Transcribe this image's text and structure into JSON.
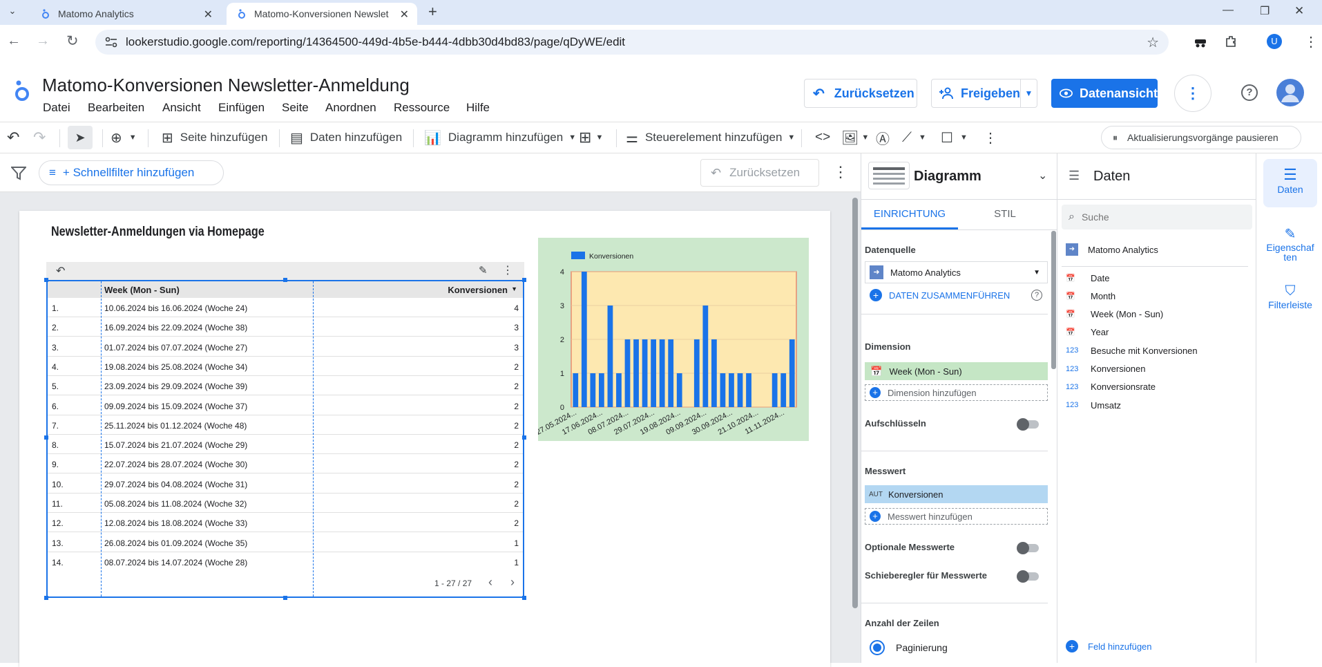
{
  "browser": {
    "tabs": [
      {
        "title": "Matomo Analytics"
      },
      {
        "title": "Matomo-Konversionen Newslet"
      }
    ],
    "url": "lookerstudio.google.com/reporting/14364500-449d-4b5e-b444-4dbb30d4bd83/page/qDyWE/edit",
    "profile_letter": "U"
  },
  "app": {
    "title": "Matomo-Konversionen Newsletter-Anmeldung",
    "menu": [
      "Datei",
      "Bearbeiten",
      "Ansicht",
      "Einfügen",
      "Seite",
      "Anordnen",
      "Ressource",
      "Hilfe"
    ],
    "reset_label": "Zurücksetzen",
    "share_label": "Freigeben",
    "view_label": "Datenansicht"
  },
  "toolbar": {
    "add_page": "Seite hinzufügen",
    "add_data": "Daten hinzufügen",
    "add_chart": "Diagramm hinzufügen",
    "add_control": "Steuerelement hinzufügen",
    "pause_updates": "Aktualisierungsvorgänge pausieren"
  },
  "filterbar": {
    "quickfilter": "+ Schnellfilter hinzufügen",
    "reset": "Zurücksetzen"
  },
  "report": {
    "title": "Newsletter-Anmeldungen via Homepage",
    "table": {
      "columns": [
        "Week (Mon - Sun)",
        "Konversionen"
      ],
      "rows": [
        {
          "n": "1.",
          "week": "10.06.2024 bis 16.06.2024 (Woche 24)",
          "value": "4"
        },
        {
          "n": "2.",
          "week": "16.09.2024 bis 22.09.2024 (Woche 38)",
          "value": "3"
        },
        {
          "n": "3.",
          "week": "01.07.2024 bis 07.07.2024 (Woche 27)",
          "value": "3"
        },
        {
          "n": "4.",
          "week": "19.08.2024 bis 25.08.2024 (Woche 34)",
          "value": "2"
        },
        {
          "n": "5.",
          "week": "23.09.2024 bis 29.09.2024 (Woche 39)",
          "value": "2"
        },
        {
          "n": "6.",
          "week": "09.09.2024 bis 15.09.2024 (Woche 37)",
          "value": "2"
        },
        {
          "n": "7.",
          "week": "25.11.2024 bis 01.12.2024 (Woche 48)",
          "value": "2"
        },
        {
          "n": "8.",
          "week": "15.07.2024 bis 21.07.2024 (Woche 29)",
          "value": "2"
        },
        {
          "n": "9.",
          "week": "22.07.2024 bis 28.07.2024 (Woche 30)",
          "value": "2"
        },
        {
          "n": "10.",
          "week": "29.07.2024 bis 04.08.2024 (Woche 31)",
          "value": "2"
        },
        {
          "n": "11.",
          "week": "05.08.2024 bis 11.08.2024 (Woche 32)",
          "value": "2"
        },
        {
          "n": "12.",
          "week": "12.08.2024 bis 18.08.2024 (Woche 33)",
          "value": "2"
        },
        {
          "n": "13.",
          "week": "26.08.2024 bis 01.09.2024 (Woche 35)",
          "value": "1"
        },
        {
          "n": "14.",
          "week": "08.07.2024 bis 14.07.2024 (Woche 28)",
          "value": "1"
        }
      ],
      "pagination": "1 - 27 / 27"
    }
  },
  "chart_data": {
    "type": "bar",
    "legend": "Konversionen",
    "legend_position": "top-left",
    "ylim": [
      0,
      4
    ],
    "yticks": [
      "0",
      "1",
      "2",
      "3",
      "4"
    ],
    "xtick_labels": [
      "27.05.2024...",
      "17.06.2024...",
      "08.07.2024...",
      "29.07.2024...",
      "19.08.2024...",
      "09.09.2024...",
      "30.09.2024...",
      "21.10.2024...",
      "11.11.2024..."
    ],
    "values": [
      1,
      4,
      1,
      1,
      3,
      1,
      2,
      2,
      2,
      2,
      2,
      2,
      1,
      0,
      2,
      3,
      2,
      1,
      1,
      1,
      1,
      0,
      0,
      1,
      1,
      2
    ],
    "grid": true,
    "colors": {
      "bar": "#1a73e8",
      "plot_bg": "#fde8b0",
      "chart_bg": "#cce8cc",
      "plot_border": "#e8735a"
    }
  },
  "props": {
    "header": "Diagramm",
    "tabs": [
      "EINRICHTUNG",
      "STIL"
    ],
    "datasource_label": "Datenquelle",
    "datasource": "Matomo Analytics",
    "merge": "DATEN ZUSAMMENFÜHREN",
    "dimension_label": "Dimension",
    "dimension": "Week (Mon - Sun)",
    "add_dimension": "Dimension hinzufügen",
    "breakdown": "Aufschlüsseln",
    "metric_label": "Messwert",
    "metric_tag": "AUT",
    "metric": "Konversionen",
    "add_metric": "Messwert hinzufügen",
    "optional_metrics": "Optionale Messwerte",
    "metric_slider": "Schieberegler für Messwerte",
    "rows_label": "Anzahl der Zeilen",
    "pagination": "Paginierung"
  },
  "data_panel": {
    "header": "Daten",
    "search_placeholder": "Suche",
    "source": "Matomo Analytics",
    "fields": [
      {
        "type": "date",
        "name": "Date"
      },
      {
        "type": "date",
        "name": "Month"
      },
      {
        "type": "date",
        "name": "Week (Mon - Sun)"
      },
      {
        "type": "date",
        "name": "Year"
      },
      {
        "type": "num",
        "name": "Besuche mit Konversionen"
      },
      {
        "type": "num",
        "name": "Konversionen"
      },
      {
        "type": "num",
        "name": "Konversionsrate"
      },
      {
        "type": "num",
        "name": "Umsatz"
      }
    ],
    "add_field": "Feld hinzufügen"
  },
  "sidebar": {
    "data": "Daten",
    "properties": "Eigenschaf ten",
    "filter": "Filterleiste"
  }
}
